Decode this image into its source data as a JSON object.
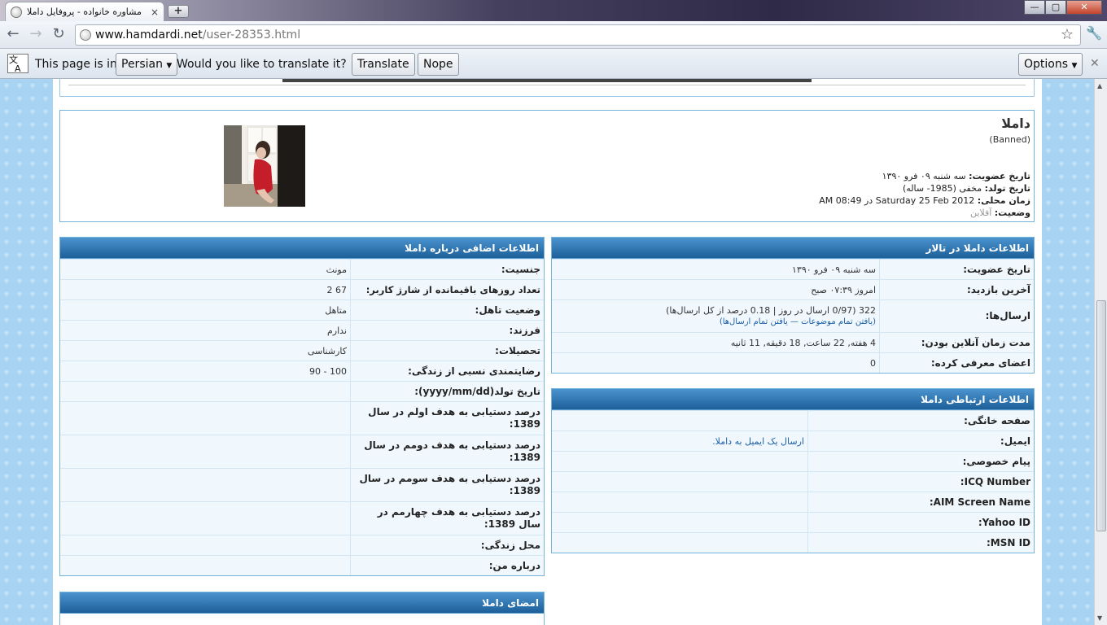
{
  "browser": {
    "tab_title": "مشاوره خانواده - پروفایل داملا",
    "tab_close": "×",
    "new_tab": "+",
    "url_host": "www.hamdardi.net",
    "url_path": "/user-28353.html",
    "window_buttons": [
      "—",
      "▢",
      "✕"
    ]
  },
  "translate_bar": {
    "this_page_is_in": "This page is in",
    "language": "Persian",
    "question": "Would you like to translate it?",
    "translate_label": "Translate",
    "nope_label": "Nope",
    "options_label": "Options"
  },
  "profile": {
    "username": "داملا",
    "user_title": "(Banned)",
    "rows": [
      {
        "label": "تاریخ عضویت:",
        "value": " سه شنبه ۰۹ فرو ۱۳۹۰"
      },
      {
        "label": "تاریخ تولد:",
        "value": " مخفی (1985- ساله)"
      },
      {
        "label": "زمان محلی:",
        "value": " Saturday 25 Feb 2012 در 08:49 AM"
      },
      {
        "label": "وضعیت:",
        "value": " آفلاین"
      }
    ]
  },
  "forum_info": {
    "title": "اطلاعات داملا در تالار",
    "rows": [
      {
        "label": "تاریخ عضویت:",
        "value": "سه شنبه ۰۹ فرو ۱۳۹۰"
      },
      {
        "label": "آخرین بازدید:",
        "value": "امروز ۰۷:۳۹ صبح"
      },
      {
        "label": "ارسال‌ها:",
        "value": "322 (0/97 ارسال در روز | 0.18 درصد از کل ارسال‌ها)",
        "link": "(یافتن تمام موضوعات — یافتن تمام ارسال‌ها)"
      },
      {
        "label": "مدت زمان آنلاین بودن:",
        "value": "4 هفته, 22 ساعت, 18 دقیقه, 11 ثانیه"
      },
      {
        "label": "اعضای معرفی کرده:",
        "value": "0"
      }
    ]
  },
  "contact_info": {
    "title": "اطلاعات ارتباطی داملا",
    "rows": [
      {
        "label": "صفحه خانگی:",
        "value": ""
      },
      {
        "label": "ایمیل:",
        "value": "ارسال یک ایمیل به داملا."
      },
      {
        "label": "پیام خصوصی:",
        "value": ""
      },
      {
        "label": "ICQ Number:",
        "value": ""
      },
      {
        "label": "AIM Screen Name:",
        "value": ""
      },
      {
        "label": "Yahoo ID:",
        "value": ""
      },
      {
        "label": "MSN ID:",
        "value": ""
      }
    ]
  },
  "extra_info": {
    "title": "اطلاعات اضافی درباره داملا",
    "rows": [
      {
        "label": "جنسیت:",
        "value": "مونث"
      },
      {
        "label": "تعداد روزهای باقیمانده از شارژ کاربر:",
        "value": "67 2"
      },
      {
        "label": "وضعیت تاهل:",
        "value": "متاهل"
      },
      {
        "label": "فرزند:",
        "value": "ندارم"
      },
      {
        "label": "تحصیلات:",
        "value": "کارشناسی"
      },
      {
        "label": "رضایتمندی نسبی از زندگی:",
        "value": "100 - 90"
      },
      {
        "label": "تاریخ تولد(yyyy/mm/dd):",
        "value": ""
      },
      {
        "label": "درصد دستیابی به هدف اولم در سال 1389:",
        "value": ""
      },
      {
        "label": "درصد دستیابی به هدف دومم در سال 1389:",
        "value": ""
      },
      {
        "label": "درصد دستیابی به هدف سومم در سال 1389:",
        "value": ""
      },
      {
        "label": "درصد دستیابی به هدف چهارمم در سال 1389:",
        "value": ""
      },
      {
        "label": "محل زندگی:",
        "value": ""
      },
      {
        "label": "درباره من:",
        "value": ""
      }
    ]
  },
  "signature": {
    "title": "امضای داملا"
  },
  "colors": {
    "panel_header": "#1d5f99",
    "row_bg": "#f1f8fd",
    "link": "#1a5fa8"
  }
}
